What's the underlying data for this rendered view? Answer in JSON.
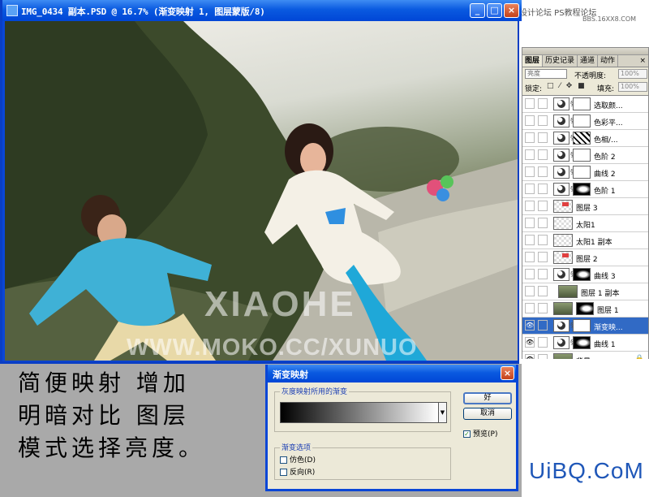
{
  "document": {
    "title": "IMG_0434 副本.PSD @ 16.7% (渐变映射 1, 图层蒙版/8)",
    "buttons": {
      "minimize": "_",
      "maximize": "□",
      "close": "×"
    },
    "watermark_main": "XIAOHE",
    "watermark_url": "WWW.MOKO.CC/XUNUO"
  },
  "site_watermark": {
    "line1": "思缘设计论坛  PS教程论坛",
    "line2": "BBS.16XX8.COM"
  },
  "layers_panel": {
    "tabs": [
      "图层",
      "历史记录",
      "通道",
      "动作"
    ],
    "active_tab": "图层",
    "close_glyph": "×",
    "blend_mode": "亮度",
    "opacity_label": "不透明度:",
    "opacity_value": "100%",
    "lock_label": "锁定:",
    "lock_icons": "□ ⁄ ✥ ■",
    "fill_label": "填充:",
    "fill_value": "100%",
    "layers": [
      {
        "name": "选取颜...",
        "kind": "adjustment",
        "mask": "plain"
      },
      {
        "name": "色彩平...",
        "kind": "adjustment",
        "mask": "plain"
      },
      {
        "name": "色相/...",
        "kind": "adjustment",
        "mask": "dots"
      },
      {
        "name": "色阶 2",
        "kind": "adjustment",
        "mask": "plain"
      },
      {
        "name": "曲线 2",
        "kind": "adjustment",
        "mask": "plain"
      },
      {
        "name": "色阶 1",
        "kind": "adjustment",
        "mask": "dark"
      },
      {
        "name": "图层 3",
        "kind": "pixel",
        "mask": "red"
      },
      {
        "name": "太阳1",
        "kind": "pixel",
        "mask": "none"
      },
      {
        "name": "太阳1 副本",
        "kind": "pixel",
        "mask": "none"
      },
      {
        "name": "图层 2",
        "kind": "pixel",
        "mask": "red"
      },
      {
        "name": "曲线 3",
        "kind": "adjustment",
        "mask": "dark"
      },
      {
        "name": "图层 1 副本",
        "kind": "photo-clip",
        "mask": "none"
      },
      {
        "name": "图层 1",
        "kind": "photo",
        "mask": "dark"
      },
      {
        "name": "渐变映...",
        "kind": "adjustment",
        "mask": "plain",
        "selected": true
      },
      {
        "name": "曲线 1",
        "kind": "adjustment",
        "mask": "dark"
      },
      {
        "name": "背景",
        "kind": "background",
        "mask": "none"
      }
    ],
    "eye_glyph": "👁",
    "lock_glyph": "🔒"
  },
  "caption": {
    "line1": "简便映射  增加",
    "line2": "明暗对比  图层",
    "line3": "模式选择亮度。"
  },
  "dialog": {
    "title": "渐变映射",
    "close_glyph": "×",
    "group1_legend": "灰度映射所用的渐变",
    "dropdown_glyph": "▼",
    "group2_legend": "渐变选项",
    "dither_label": "仿色(D)",
    "reverse_label": "反向(R)",
    "ok_label": "好",
    "cancel_label": "取消",
    "preview_label": "预览(P)",
    "preview_checked": true,
    "check_glyph": "✓"
  },
  "branding": {
    "text": "UiBQ.CoM"
  }
}
